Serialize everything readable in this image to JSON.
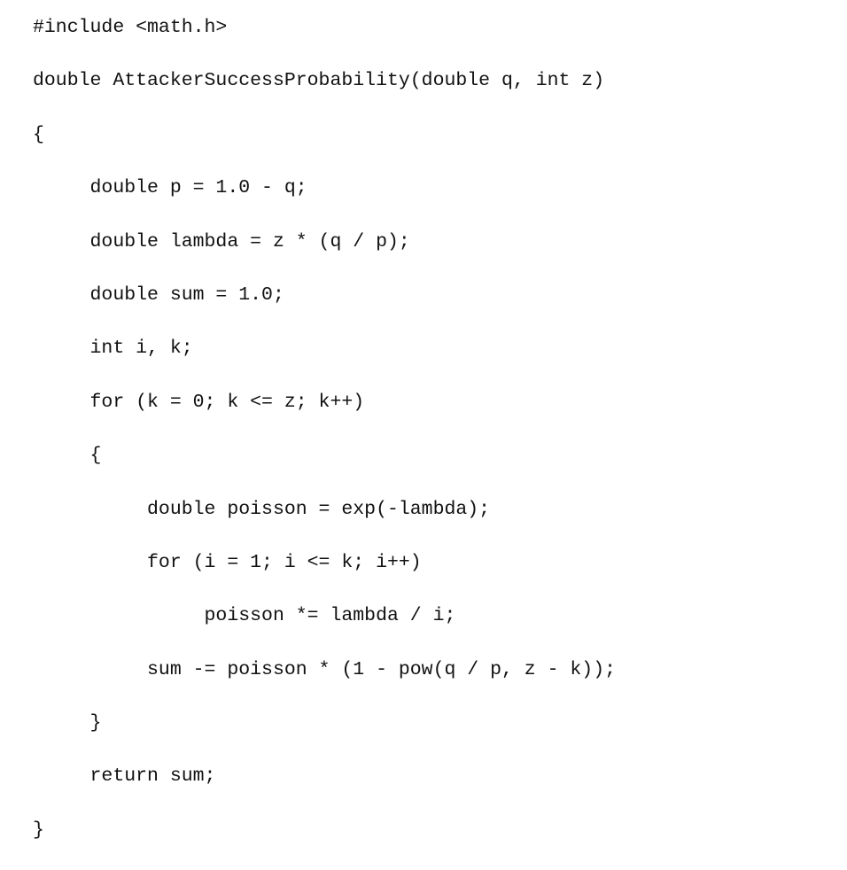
{
  "code": {
    "language": "c",
    "lines": [
      "#include <math.h>",
      "double AttackerSuccessProbability(double q, int z)",
      "{",
      "     double p = 1.0 - q;",
      "     double lambda = z * (q / p);",
      "     double sum = 1.0;",
      "     int i, k;",
      "     for (k = 0; k <= z; k++)",
      "     {",
      "          double poisson = exp(-lambda);",
      "          for (i = 1; i <= k; i++)",
      "               poisson *= lambda / i;",
      "          sum -= poisson * (1 - pow(q / p, z - k));",
      "     }",
      "     return sum;",
      "}"
    ]
  }
}
